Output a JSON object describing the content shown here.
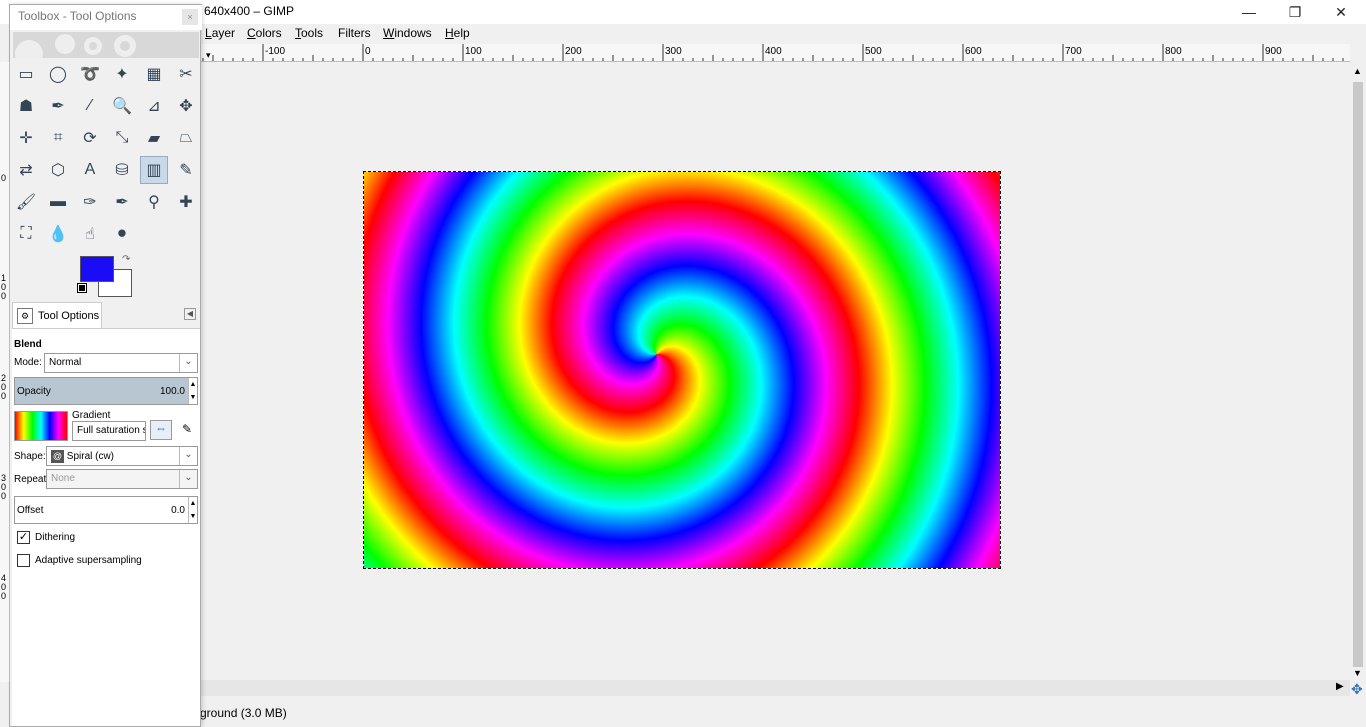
{
  "window": {
    "title": "640x400 – GIMP",
    "minimize": "—",
    "restore": "❐",
    "close": "✕"
  },
  "menubar": {
    "items": [
      {
        "label": "Layer",
        "u": "L",
        "rest": "ayer"
      },
      {
        "label": "Colors",
        "u": "C",
        "rest": "olors"
      },
      {
        "label": "Tools",
        "u": "T",
        "rest": "ools"
      },
      {
        "label": "Filters",
        "u": "",
        "rest": "Filters"
      },
      {
        "label": "Windows",
        "u": "W",
        "rest": "indows"
      },
      {
        "label": "Help",
        "u": "H",
        "rest": "elp"
      }
    ]
  },
  "ruler": {
    "h_labels": [
      "-100",
      "0",
      "100",
      "200",
      "300",
      "400",
      "500",
      "600",
      "700",
      "800",
      "900"
    ],
    "v_labels": [
      "0",
      "100",
      "200",
      "300",
      "400"
    ]
  },
  "toolbox": {
    "title": "Toolbox - Tool Options",
    "close": "×",
    "tools": [
      {
        "name": "rect-select-icon",
        "glyph": "▭"
      },
      {
        "name": "ellipse-select-icon",
        "glyph": "◯"
      },
      {
        "name": "free-select-icon",
        "glyph": "➰"
      },
      {
        "name": "fuzzy-select-icon",
        "glyph": "✦"
      },
      {
        "name": "select-by-color-icon",
        "glyph": "▦"
      },
      {
        "name": "scissors-select-icon",
        "glyph": "✂"
      },
      {
        "name": "foreground-select-icon",
        "glyph": "☗"
      },
      {
        "name": "paths-icon",
        "glyph": "✒"
      },
      {
        "name": "color-picker-icon",
        "glyph": "⁄"
      },
      {
        "name": "zoom-icon",
        "glyph": "🔍"
      },
      {
        "name": "measure-icon",
        "glyph": "⊿"
      },
      {
        "name": "move-icon",
        "glyph": "✥"
      },
      {
        "name": "align-icon",
        "glyph": "✛"
      },
      {
        "name": "crop-icon",
        "glyph": "⌗"
      },
      {
        "name": "rotate-icon",
        "glyph": "⟳"
      },
      {
        "name": "scale-icon",
        "glyph": "⤡"
      },
      {
        "name": "shear-icon",
        "glyph": "▰"
      },
      {
        "name": "perspective-icon",
        "glyph": "⏢"
      },
      {
        "name": "flip-icon",
        "glyph": "⇄"
      },
      {
        "name": "cage-transform-icon",
        "glyph": "⬡"
      },
      {
        "name": "text-icon",
        "glyph": "A"
      },
      {
        "name": "bucket-fill-icon",
        "glyph": "⛁"
      },
      {
        "name": "blend-icon",
        "glyph": "▥"
      },
      {
        "name": "pencil-icon",
        "glyph": "✎"
      },
      {
        "name": "paintbrush-icon",
        "glyph": "🖌"
      },
      {
        "name": "eraser-icon",
        "glyph": "▬"
      },
      {
        "name": "airbrush-icon",
        "glyph": "✑"
      },
      {
        "name": "ink-icon",
        "glyph": "✒"
      },
      {
        "name": "clone-icon",
        "glyph": "⚲"
      },
      {
        "name": "heal-icon",
        "glyph": "✚"
      },
      {
        "name": "perspective-clone-icon",
        "glyph": "⛶"
      },
      {
        "name": "blur-sharpen-icon",
        "glyph": "💧"
      },
      {
        "name": "smudge-icon",
        "glyph": "☝"
      },
      {
        "name": "dodge-burn-icon",
        "glyph": "⚫"
      }
    ],
    "active_tool": "blend-icon",
    "fg_color": "#1a0cf5",
    "bg_color": "#ffffff"
  },
  "tool_options": {
    "tab_label": "Tool Options",
    "heading": "Blend",
    "mode_label": "Mode:",
    "mode_value": "Normal",
    "opacity_label": "Opacity",
    "opacity_value": "100.0",
    "gradient_label": "Gradient",
    "gradient_name": "Full saturation s",
    "shape_label": "Shape:",
    "shape_value": "Spiral (cw)",
    "repeat_label": "Repeat:",
    "repeat_value": "None",
    "offset_label": "Offset",
    "offset_value": "0.0",
    "dithering_label": "Dithering",
    "dithering_checked": true,
    "adaptive_label": "Adaptive supersampling",
    "adaptive_checked": false
  },
  "status": {
    "text": "ground (3.0 MB)"
  }
}
